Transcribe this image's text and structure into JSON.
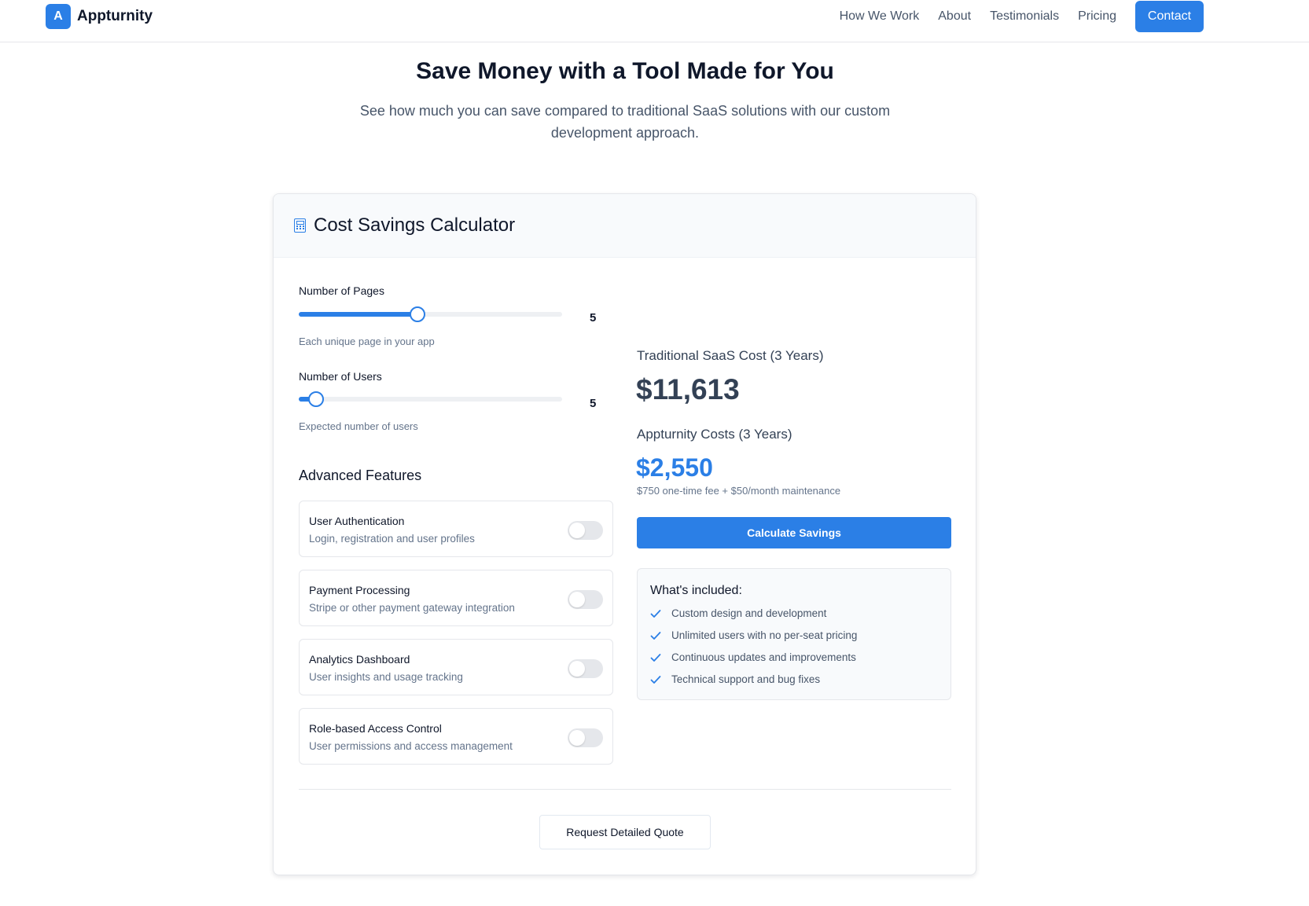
{
  "brand": {
    "logo_letter": "A",
    "name": "Appturnity",
    "accent": "#2b7fe6"
  },
  "nav": {
    "items": [
      "How We Work",
      "About",
      "Testimonials",
      "Pricing"
    ],
    "contact_label": "Contact"
  },
  "hero": {
    "title": "Save Money with a Tool Made for You",
    "subtitle": "See how much you can save compared to traditional SaaS solutions with our custom development approach."
  },
  "calculator": {
    "title": "Cost Savings Calculator",
    "icon": "calculator-icon",
    "pages": {
      "label": "Number of Pages",
      "value": "5",
      "hint": "Each unique page in your app",
      "fill_fraction": 0.45
    },
    "users": {
      "label": "Number of Users",
      "value": "5",
      "hint": "Expected number of users",
      "fill_fraction": 0.065
    },
    "advanced_title": "Advanced Features",
    "features": [
      {
        "name": "User Authentication",
        "desc": "Login, registration and user profiles",
        "enabled": false
      },
      {
        "name": "Payment Processing",
        "desc": "Stripe or other payment gateway integration",
        "enabled": false
      },
      {
        "name": "Analytics Dashboard",
        "desc": "User insights and usage tracking",
        "enabled": false
      },
      {
        "name": "Role-based Access Control",
        "desc": "User permissions and access management",
        "enabled": false
      }
    ],
    "traditional_label": "Traditional SaaS Cost (3 Years)",
    "traditional_value": "$11,613",
    "appturnity_label": "Appturnity Costs (3 Years)",
    "appturnity_value": "$2,550",
    "appturnity_note": "$750 one-time fee + $50/month maintenance",
    "calculate_label": "Calculate Savings",
    "included_title": "What's included:",
    "included_items": [
      "Custom design and development",
      "Unlimited users with no per-seat pricing",
      "Continuous updates and improvements",
      "Technical support and bug fixes"
    ],
    "quote_label": "Request Detailed Quote"
  }
}
